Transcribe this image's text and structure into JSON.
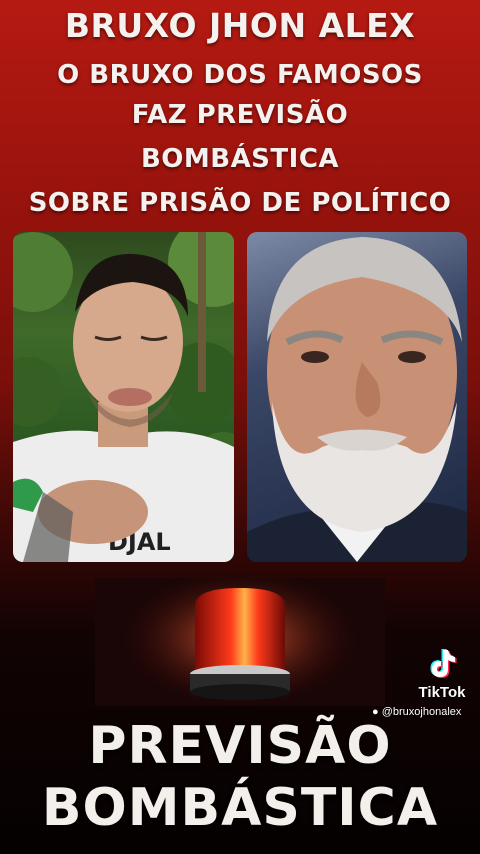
{
  "headline": {
    "line1": "BRUXO JHON ALEX",
    "line2": "O BRUXO DOS FAMOSOS",
    "line3": "FAZ PREVISÃO",
    "line4": "BOMBÁSTICA",
    "line5": "SOBRE PRISÃO DE POLÍTICO"
  },
  "shirt_text": "DJAL",
  "watermark": {
    "brand": "TikTok",
    "handle": "@bruxojhonalex"
  },
  "bottom_title": {
    "line1": "PREVISÃO",
    "line2": "BOMBÁSTICA"
  },
  "colors": {
    "background_top": "#b51a12",
    "background_bottom": "#050101",
    "text": "#f4f1ee",
    "siren_red": "#e2231a"
  }
}
